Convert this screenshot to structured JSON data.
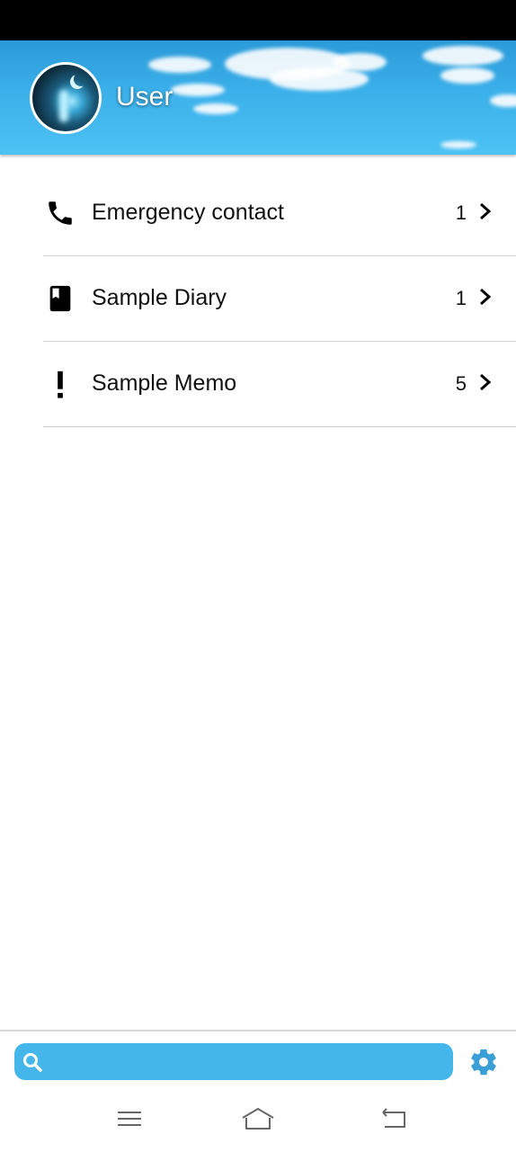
{
  "header": {
    "username": "User"
  },
  "list": {
    "items": [
      {
        "label": "Emergency contact",
        "count": "1",
        "icon": "phone-icon"
      },
      {
        "label": "Sample Diary",
        "count": "1",
        "icon": "book-icon"
      },
      {
        "label": "Sample Memo",
        "count": "5",
        "icon": "exclamation-icon"
      }
    ]
  },
  "bottom": {
    "search_value": "",
    "accent": "#45b6e9"
  },
  "colors": {
    "header_sky": "#3bb0ea",
    "search_bar": "#45b6e9",
    "gear": "#3a9fd6"
  }
}
